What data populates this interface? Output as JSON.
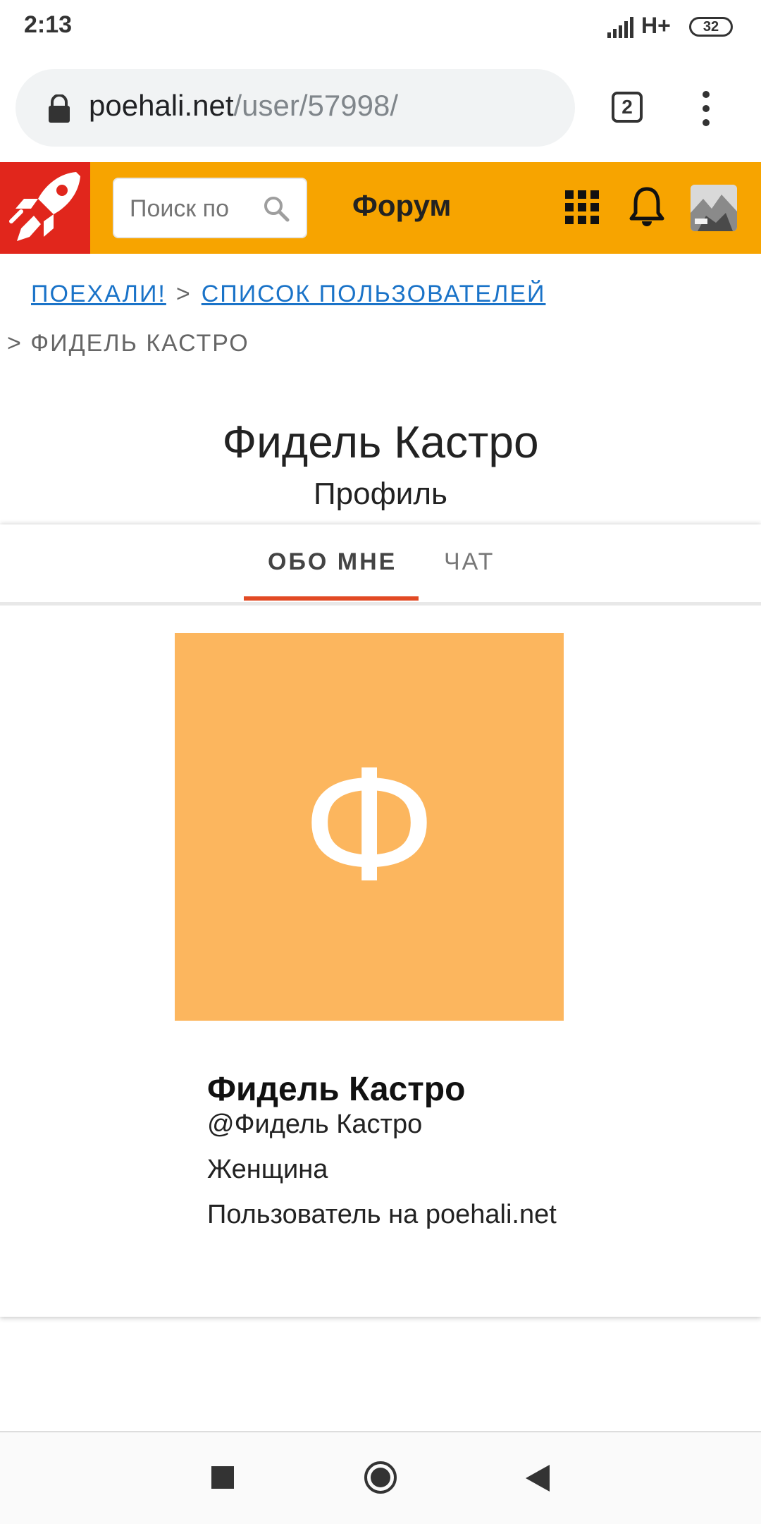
{
  "status": {
    "time": "2:13",
    "network": "H+",
    "battery": "32"
  },
  "browser": {
    "url_domain": "poehali.net",
    "url_path": "/user/57998/",
    "tab_count": "2"
  },
  "header": {
    "search_placeholder": "Поиск по",
    "forum_label": "Форум"
  },
  "breadcrumb": {
    "home": "ПОЕХАЛИ!",
    "users": "СПИСОК ПОЛЬЗОВАТЕЛЕЙ",
    "sep": ">",
    "current": "> ФИДЕЛЬ КАСТРО"
  },
  "page": {
    "title": "Фидель Кастро",
    "subtitle": "Профиль"
  },
  "tabs": [
    {
      "label": "ОБО МНЕ"
    },
    {
      "label": "ЧАТ"
    }
  ],
  "profile": {
    "avatar_letter": "Ф",
    "avatar_color": "#fcb65e",
    "name": "Фидель Кастро",
    "handle": "@Фидель Кастро",
    "gender": "Женщина",
    "role": "Пользователь на poehali.net"
  },
  "colors": {
    "header_bg": "#f7a400",
    "logo_bg": "#e1261c",
    "active_tab": "#e24a24",
    "link": "#1a73c8"
  }
}
